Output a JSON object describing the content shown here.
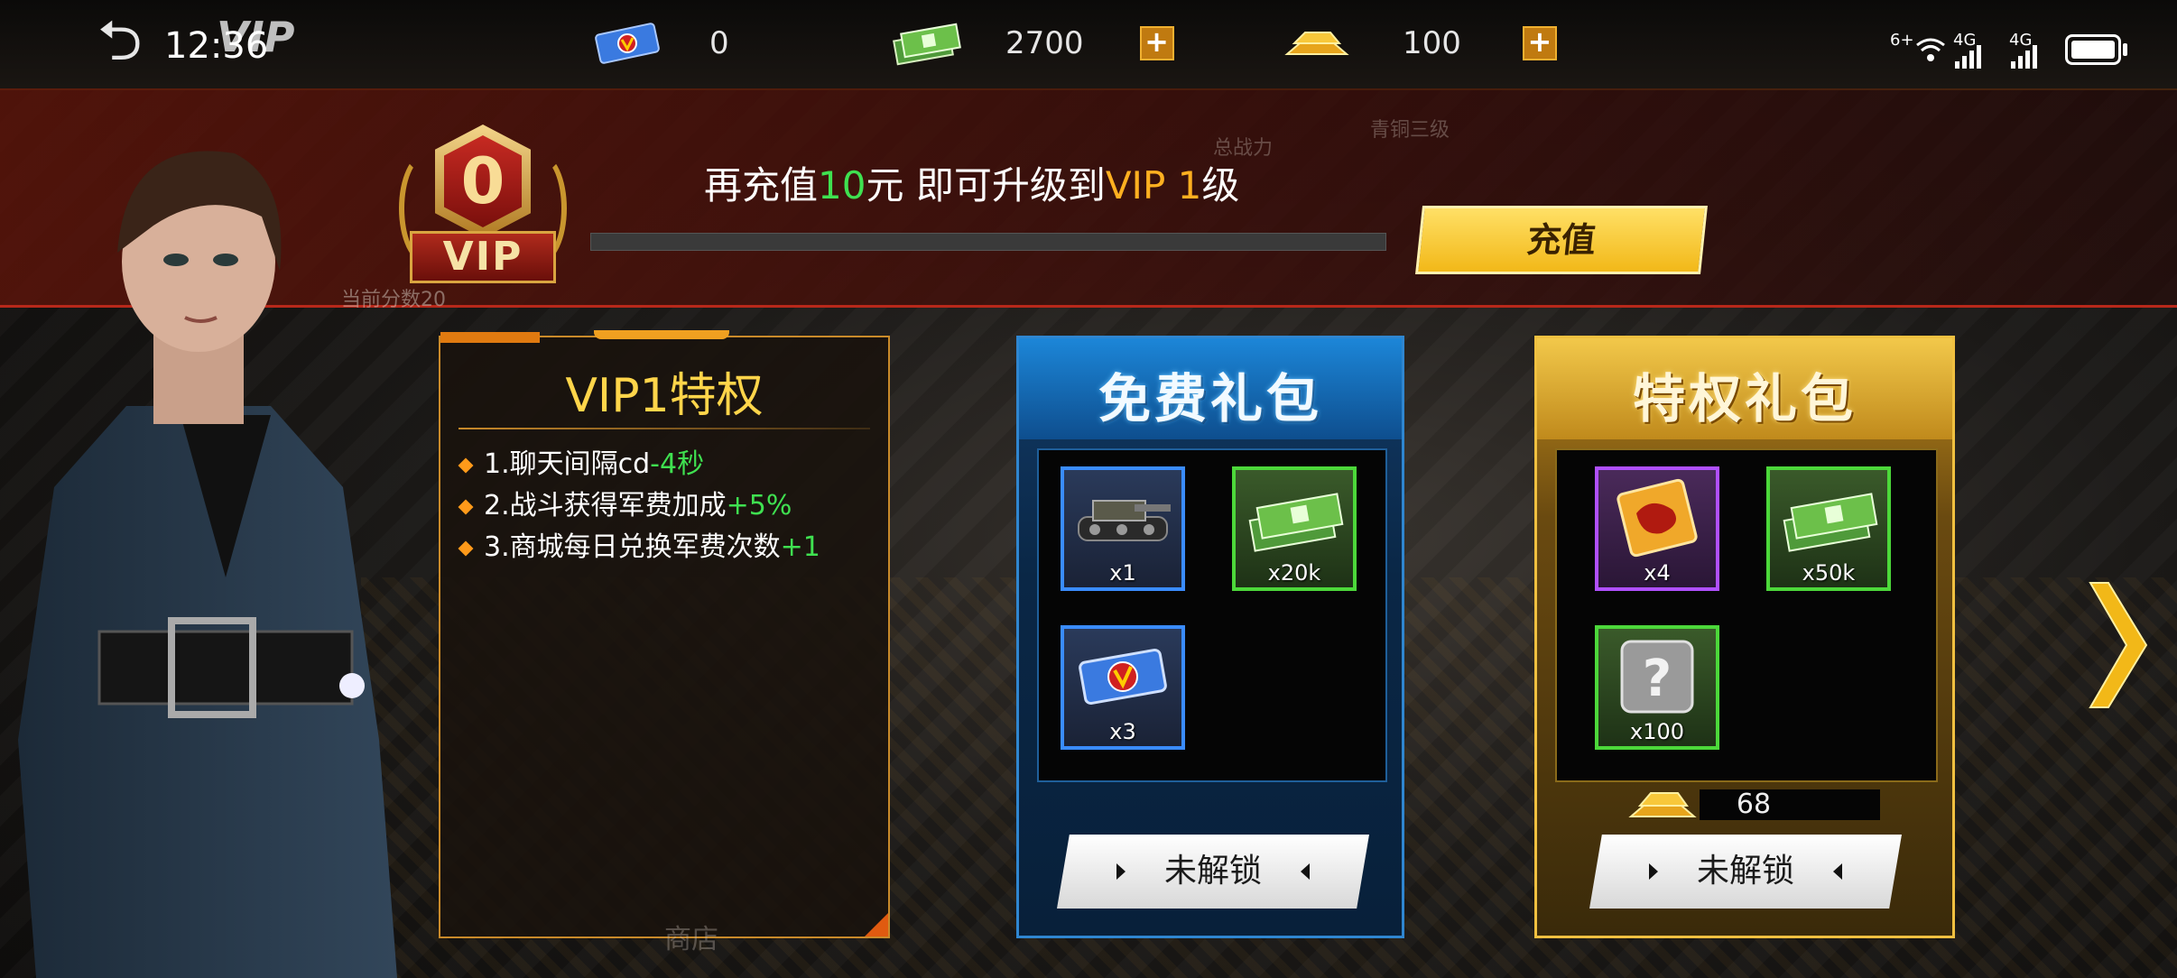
{
  "status_bar": {
    "time": "12:36",
    "net1": "6+",
    "net2": "4G",
    "net3": "4G"
  },
  "header": {
    "back_title": "VIP"
  },
  "resources": [
    {
      "icon": "ticket-icon",
      "value": "0",
      "has_plus": false
    },
    {
      "icon": "cash-icon",
      "value": "2700",
      "has_plus": true
    },
    {
      "icon": "gold-bar-icon",
      "value": "100",
      "has_plus": true
    }
  ],
  "plus_label": "+",
  "background_text": {
    "power_label": "总战力",
    "rank_label": "青铜三级",
    "score_label": "当前分数20",
    "shop_label": "商店"
  },
  "vip": {
    "level": "0",
    "badge_text": "VIP",
    "msg_prefix": "再充值",
    "msg_amount": "10",
    "msg_mid": "元 即可升级到",
    "msg_target": "VIP 1",
    "msg_suffix": "级",
    "progress": 0,
    "recharge_label": "充值"
  },
  "privileges": {
    "title": "VIP1特权",
    "items": [
      {
        "text": "1.聊天间隔cd",
        "bonus": "-4秒"
      },
      {
        "text": "2.战斗获得军费加成",
        "bonus": "+5%"
      },
      {
        "text": "3.商城每日兑换军费次数",
        "bonus": "+1"
      }
    ]
  },
  "free_gift": {
    "title": "免费礼包",
    "items": [
      {
        "icon": "tank-icon",
        "qty": "x1",
        "rarity": "blue"
      },
      {
        "icon": "cash-stack-icon",
        "qty": "x20k",
        "rarity": "green"
      },
      {
        "icon": "ticket-icon",
        "qty": "x3",
        "rarity": "blue"
      }
    ],
    "button": "未解锁"
  },
  "privilege_gift": {
    "title": "特权礼包",
    "items": [
      {
        "icon": "card-icon",
        "qty": "x4",
        "rarity": "purple"
      },
      {
        "icon": "cash-stack-icon",
        "qty": "x50k",
        "rarity": "green"
      },
      {
        "icon": "mystery-box-icon",
        "qty": "x100",
        "rarity": "green"
      }
    ],
    "price": "68",
    "button": "未解锁"
  },
  "colors": {
    "accent_gold": "#ffd54a",
    "bonus_green": "#3fe050",
    "vip_orange": "#ffb020",
    "free_blue": "#2f86d0"
  }
}
